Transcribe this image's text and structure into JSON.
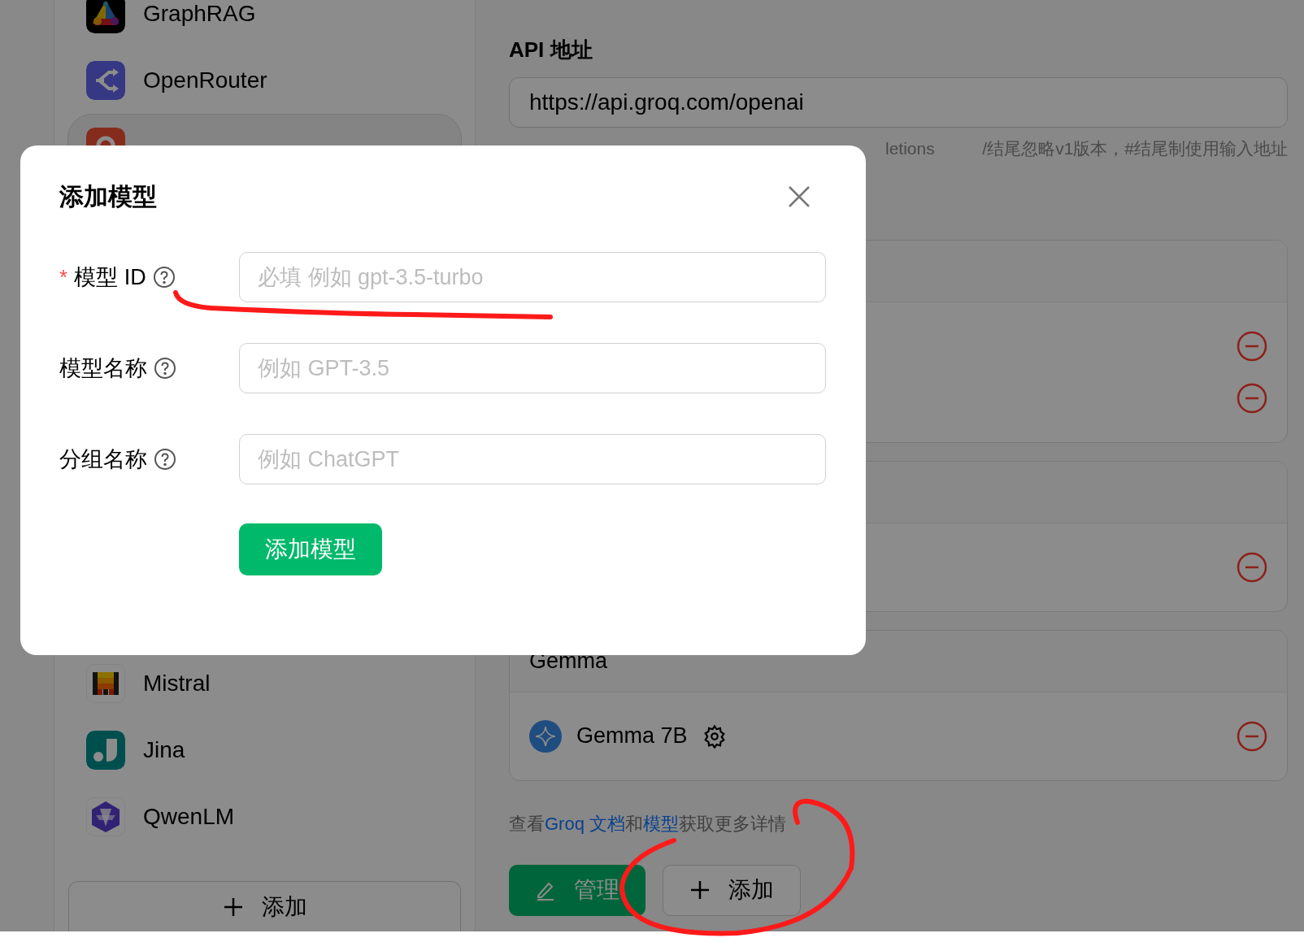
{
  "sidebar": {
    "providers_top": [
      {
        "name": "GraphRAG",
        "selected": false
      },
      {
        "name": "OpenRouter",
        "selected": false
      },
      {
        "selected": true
      }
    ],
    "providers_bottom": [
      {
        "name": "Mistral",
        "selected": false
      },
      {
        "name": "Jina",
        "selected": false
      },
      {
        "name": "QwenLM",
        "selected": false
      }
    ],
    "add_button": {
      "label": "添加"
    }
  },
  "api_address": {
    "label": "API 地址",
    "value": "https://api.groq.com/openai",
    "hint_fragment": "letions",
    "hint_note": "/结尾忽略v1版本，#结尾制使用输入地址"
  },
  "model_groups": [
    {
      "models": [
        {
          "kind": "covered"
        },
        {
          "kind": "covered"
        }
      ]
    },
    {
      "models": [
        {
          "kind": "covered"
        }
      ]
    },
    {
      "name": "Gemma",
      "models": [
        {
          "kind": "full",
          "name": "Gemma 7B"
        }
      ]
    }
  ],
  "help": [
    {
      "kind": "plain",
      "text": "查看"
    },
    {
      "kind": "link",
      "text": "Groq 文档"
    },
    {
      "kind": "plain",
      "text": "和"
    },
    {
      "kind": "link",
      "text": "模型"
    },
    {
      "kind": "plain",
      "text": "获取更多详情"
    }
  ],
  "actions": [
    {
      "kind": "primary",
      "label": "管理"
    },
    {
      "kind": "default",
      "label": "添加"
    }
  ],
  "dialog": {
    "title": "添加模型",
    "fields": [
      {
        "mark": "*",
        "label": "模型 ID",
        "placeholder": "必填 例如 gpt-3.5-turbo"
      },
      {
        "label": "模型名称",
        "placeholder": "例如 GPT-3.5"
      },
      {
        "label": "分组名称",
        "placeholder": "例如 ChatGPT"
      }
    ],
    "submit": "添加模型"
  }
}
